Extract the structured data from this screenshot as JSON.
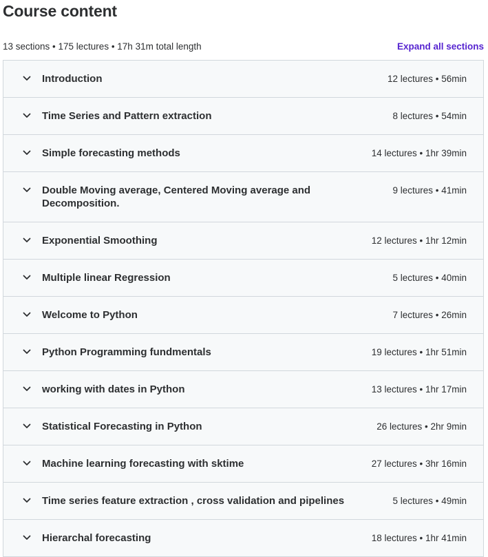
{
  "header": {
    "title": "Course content",
    "summary": "13 sections • 175 lectures • 17h 31m total length",
    "expand_all_label": "Expand all sections"
  },
  "icons": {
    "chevron": "chevron-down-icon"
  },
  "colors": {
    "accent": "#5624d0",
    "text": "#2d2f31",
    "row_bg": "#f7f9fa",
    "border": "#d1d7dc"
  },
  "sections": [
    {
      "title": "Introduction",
      "meta": "12 lectures • 56min"
    },
    {
      "title": "Time Series and Pattern extraction",
      "meta": "8 lectures • 54min"
    },
    {
      "title": "Simple forecasting methods",
      "meta": "14 lectures • 1hr 39min"
    },
    {
      "title": "Double Moving average, Centered Moving average and Decomposition.",
      "meta": "9 lectures • 41min"
    },
    {
      "title": "Exponential Smoothing",
      "meta": "12 lectures • 1hr 12min"
    },
    {
      "title": "Multiple linear Regression",
      "meta": "5 lectures • 40min"
    },
    {
      "title": "Welcome to Python",
      "meta": "7 lectures • 26min"
    },
    {
      "title": "Python Programming fundmentals",
      "meta": "19 lectures • 1hr 51min"
    },
    {
      "title": "working with dates in Python",
      "meta": "13 lectures • 1hr 17min"
    },
    {
      "title": "Statistical Forecasting in Python",
      "meta": "26 lectures • 2hr 9min"
    },
    {
      "title": "Machine learning forecasting with sktime",
      "meta": "27 lectures • 3hr 16min"
    },
    {
      "title": "Time series feature extraction , cross validation and pipelines",
      "meta": "5 lectures • 49min"
    },
    {
      "title": "Hierarchal forecasting",
      "meta": "18 lectures • 1hr 41min"
    }
  ]
}
